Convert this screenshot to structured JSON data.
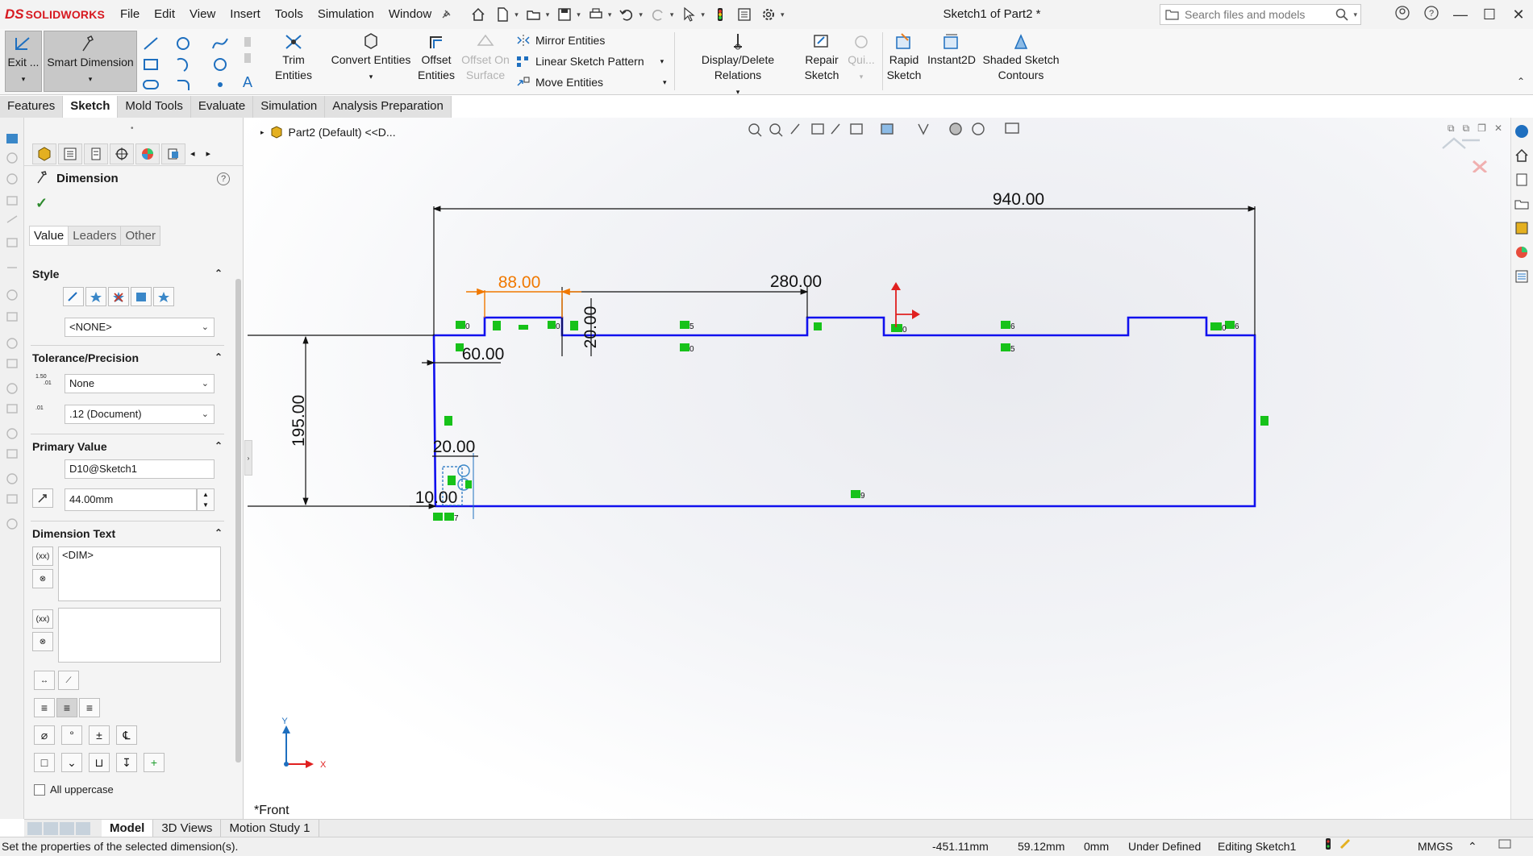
{
  "app": {
    "logo_ds": "DS",
    "logo_text": "SOLIDWORKS"
  },
  "menu": [
    "File",
    "Edit",
    "View",
    "Insert",
    "Tools",
    "Simulation",
    "Window"
  ],
  "document_title": "Sketch1 of Part2 *",
  "search": {
    "placeholder": "Search files and models"
  },
  "ribbon": {
    "exit_label": "Exit ...",
    "smart_dimension_label": "Smart Dimension",
    "trim_label": "Trim Entities",
    "convert_label": "Convert Entities",
    "offset_label_1": "Offset",
    "offset_label_2": "Entities",
    "offset_surface_1": "Offset On",
    "offset_surface_2": "Surface",
    "mirror_label": "Mirror Entities",
    "linear_pattern_label": "Linear Sketch Pattern",
    "move_label": "Move Entities",
    "display_relations_label": "Display/Delete Relations",
    "repair_1": "Repair",
    "repair_2": "Sketch",
    "quick_label": "Qui...",
    "rapid_1": "Rapid",
    "rapid_2": "Sketch",
    "instant2d_label": "Instant2D",
    "shaded_1": "Shaded Sketch",
    "shaded_2": "Contours"
  },
  "command_tabs": [
    "Features",
    "Sketch",
    "Mold Tools",
    "Evaluate",
    "Simulation",
    "Analysis Preparation"
  ],
  "property_manager": {
    "title": "Dimension",
    "tabs": [
      "Value",
      "Leaders",
      "Other"
    ],
    "style_header": "Style",
    "style_value": "<NONE>",
    "tolerance_header": "Tolerance/Precision",
    "tolerance_value": "None",
    "precision_value": ".12 (Document)",
    "primary_value_header": "Primary Value",
    "dim_name": "D10@Sketch1",
    "dim_value": "44.00mm",
    "dimension_text_header": "Dimension Text",
    "dim_text": "<DIM>",
    "all_uppercase_label": "All uppercase",
    "tol_icon_text_1": "1.50",
    "tol_icon_text_2": ".01",
    "prec_icon_text": ".01"
  },
  "tree": {
    "part_label": "Part2 (Default) <<D..."
  },
  "sketch": {
    "dims": {
      "d940": "940.00",
      "d280": "280.00",
      "d88": "88.00",
      "d60": "60.00",
      "d20v": "20.00",
      "d195": "195.00",
      "d20h": "20.00",
      "d10": "10.00"
    },
    "relation_labels": [
      "0",
      "0",
      "5",
      "0",
      "0",
      "6",
      "5",
      "0",
      "6",
      "7",
      "9"
    ],
    "view_label": "*Front",
    "axis_x": "X",
    "axis_y": "Y",
    "colors": {
      "sketch_line": "#1010ee",
      "dimension": "#111111",
      "selected_dim": "#f07800",
      "relation": "#17c21a"
    }
  },
  "bottom_tabs": [
    "Model",
    "3D Views",
    "Motion Study 1"
  ],
  "status": {
    "message": "Set the properties of the selected dimension(s).",
    "x": "-451.11mm",
    "y": "59.12mm",
    "z": "0mm",
    "state": "Under Defined",
    "editing": "Editing Sketch1",
    "units": "MMGS"
  }
}
